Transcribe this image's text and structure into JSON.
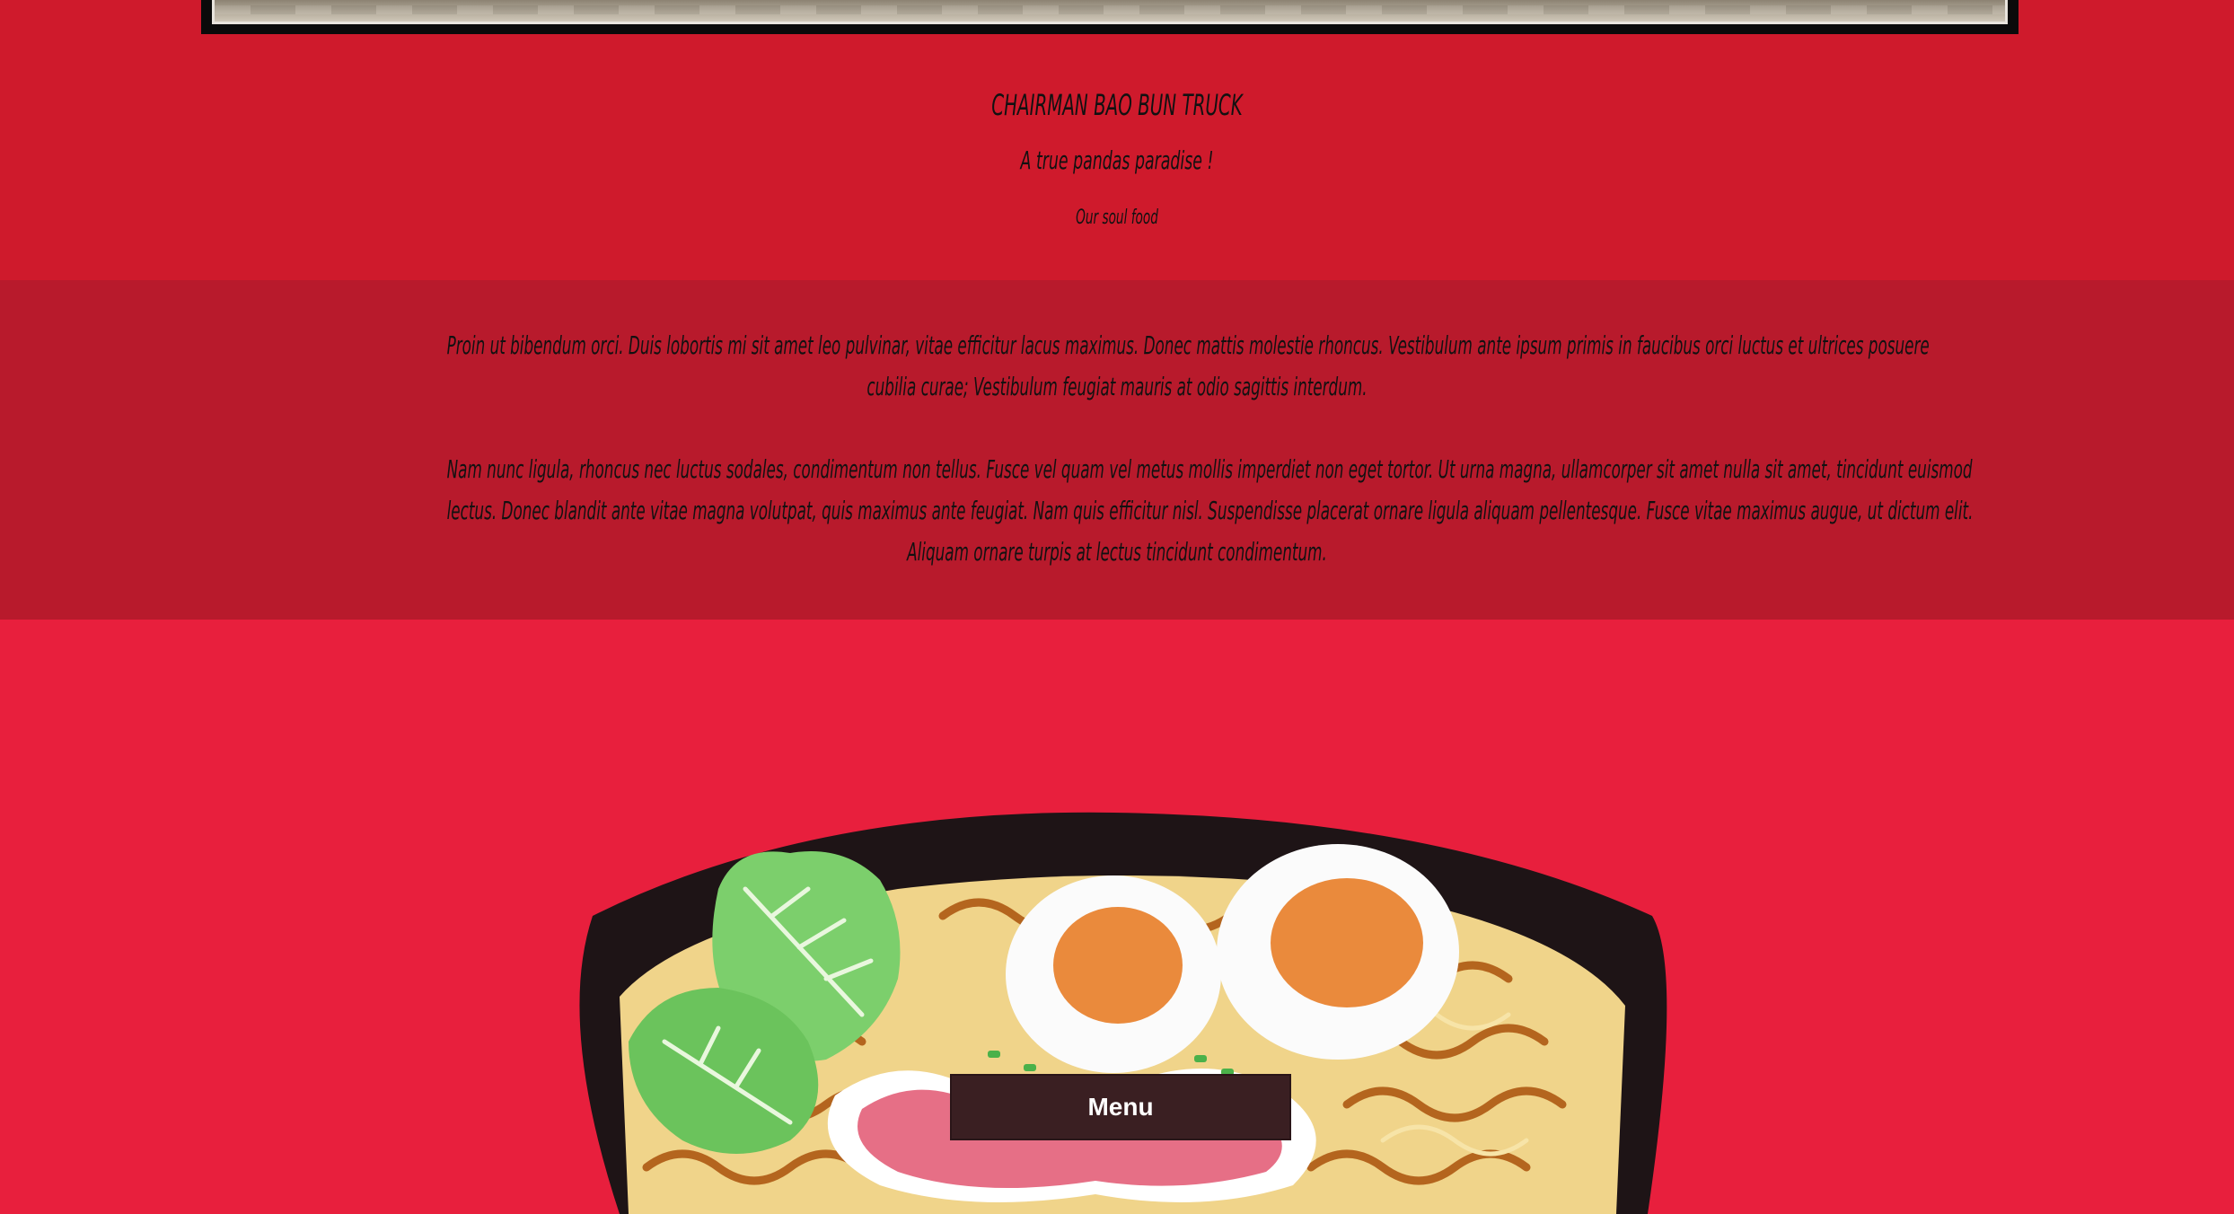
{
  "header": {
    "title": "CHAIRMAN BAO BUN TRUCK",
    "tagline": "A true pandas paradise !",
    "subtagline": "Our soul food"
  },
  "about": {
    "paragraph1_lines": [
      "Proin ut bibendum orci. Duis lobortis mi sit amet leo pulvinar, vitae efficitur lacus maximus. Donec mattis molestie rhoncus. Vestibulum ante ipsum primis in faucibus orci luctus et ultrices posuere",
      "cubilia curae; Vestibulum feugiat mauris at odio sagittis interdum."
    ],
    "paragraph2_lines": [
      "Nam nunc ligula, rhoncus nec luctus sodales, condimentum non tellus. Fusce vel quam vel metus mollis imperdiet non eget tortor. Ut urna magna, ullamcorper sit amet nulla sit amet, tincidunt euismod",
      "lectus. Donec blandit ante vitae magna volutpat, quis maximus ante feugiat. Nam quis efficitur nisl. Suspendisse placerat ornare ligula aliquam pellentesque. Fusce vitae maximus augue, ut dictum elit.",
      "Aliquam ornare turpis at lectus tincidunt condimentum."
    ]
  },
  "cta": {
    "menu_label": "Menu"
  },
  "colors": {
    "top_bg": "#cf1a2c",
    "text_band_bg": "#b81a2c",
    "bottom_bg": "#e81f3d",
    "button_bg": "#3a1f22"
  },
  "icons": {
    "illustration": "ramen-bowl-illustration"
  }
}
